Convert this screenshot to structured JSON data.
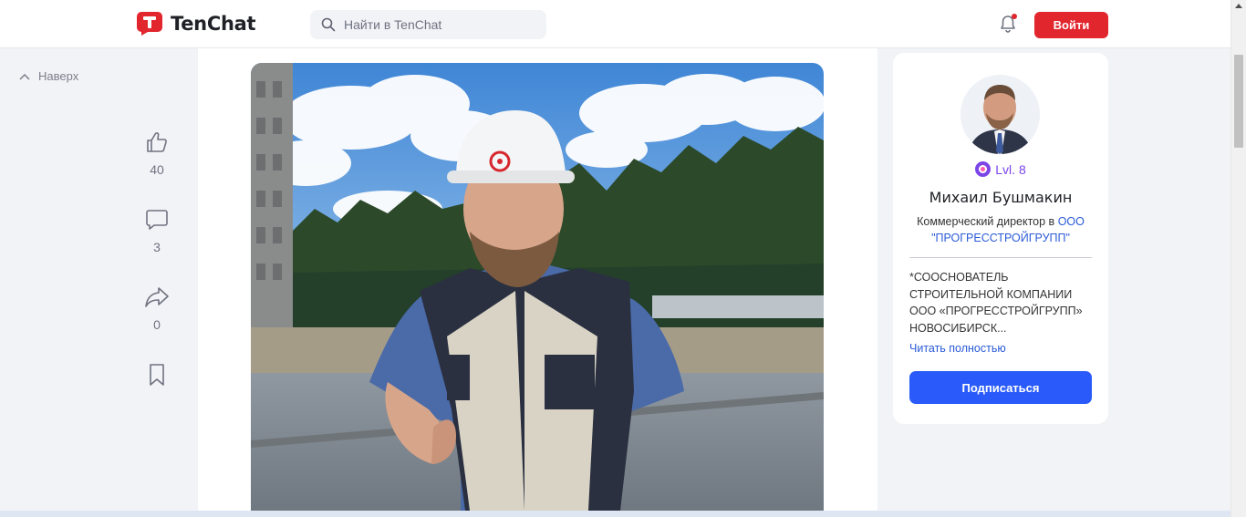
{
  "header": {
    "brand": "TenChat",
    "search_placeholder": "Найти в TenChat",
    "login_label": "Войти",
    "notification_unread": true
  },
  "sidebar": {
    "back_to_top": "Наверх",
    "actions": [
      {
        "icon": "thumbs-up-icon",
        "count": "40"
      },
      {
        "icon": "comment-icon",
        "count": "3"
      },
      {
        "icon": "share-icon",
        "count": "0"
      },
      {
        "icon": "bookmark-icon"
      }
    ]
  },
  "post": {
    "photo": "man-in-hardhat-thumbs-up-construction-site"
  },
  "profile": {
    "level": "Lvl. 8",
    "name": "Михаил Бушмакин",
    "position_prefix": "Коммерческий директор в",
    "company": "ООО \"ПРОГРЕССТРОЙГРУПП\"",
    "bio": "*СООСНОВАТЕЛЬ СТРОИТЕЛЬНОЙ КОМПАНИИ ООО «ПРОГРЕССТРОЙГРУПП» НОВОСИБИРСК...",
    "read_more": "Читать полностью",
    "subscribe": "Подписаться"
  },
  "colors": {
    "brand_red": "#e1262e",
    "link_blue": "#2a5bd7",
    "button_blue": "#2a5bfa",
    "level_purple": "#7b45e8"
  }
}
